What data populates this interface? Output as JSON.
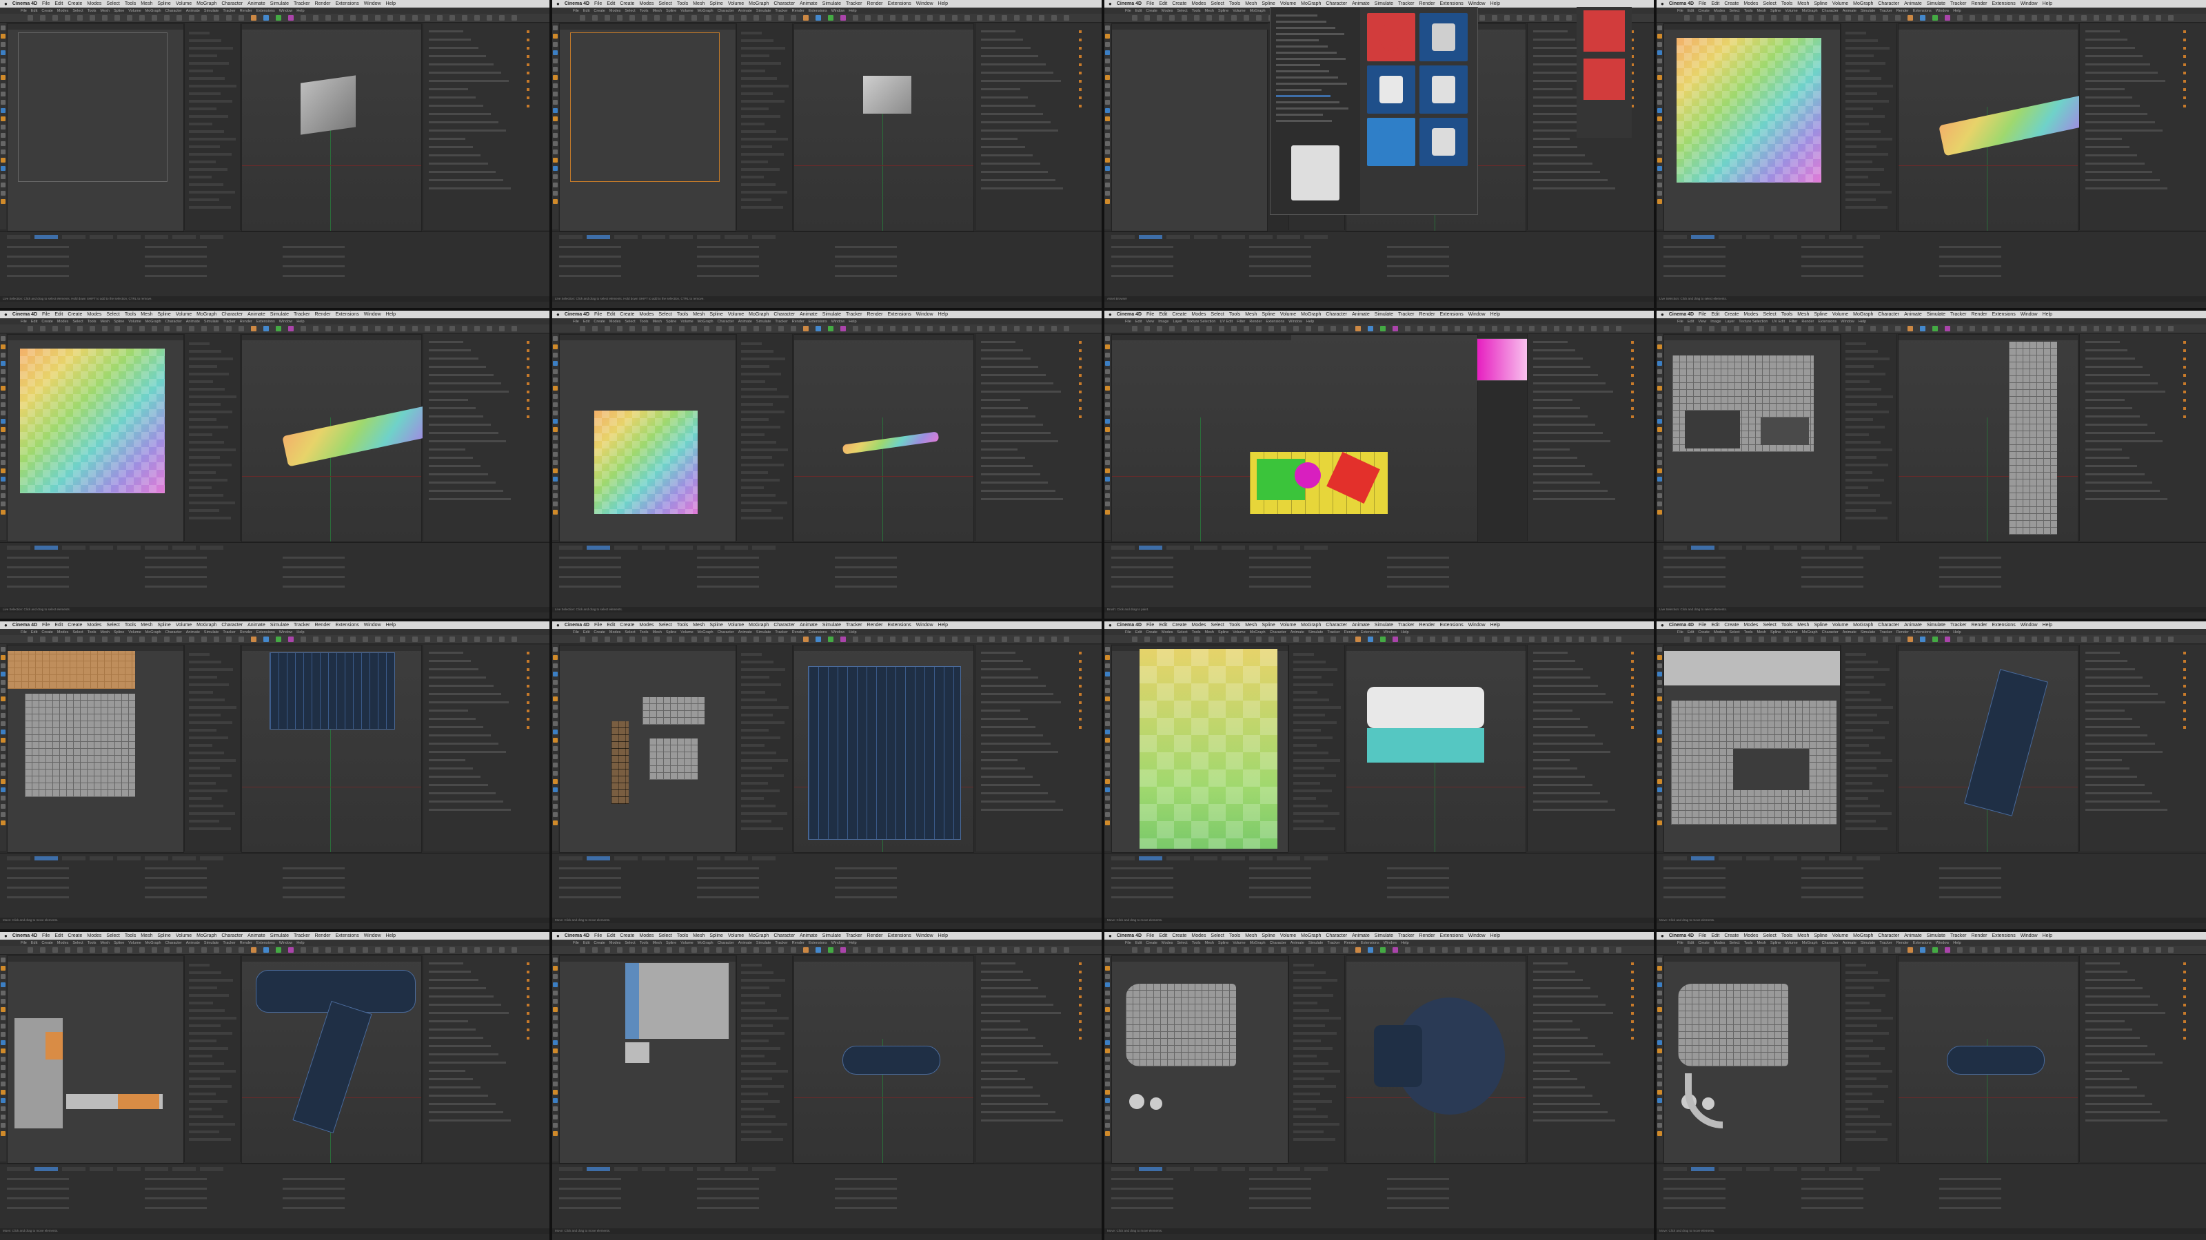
{
  "menubar": {
    "app_name": "Cinema 4D",
    "items": [
      "File",
      "Edit",
      "Create",
      "Modes",
      "Select",
      "Tools",
      "Mesh",
      "Spline",
      "Volume",
      "MoGraph",
      "Character",
      "Animate",
      "Simulate",
      "Tracker",
      "Render",
      "Extensions",
      "Window",
      "Help"
    ],
    "alt_items": [
      "File",
      "Edit",
      "View",
      "Image",
      "Layer",
      "Texture Selection",
      "UV Edit",
      "Filter",
      "Render",
      "Extensions",
      "Window",
      "Help"
    ]
  },
  "panels": [
    {
      "id": "p01",
      "variant": "cube",
      "uv": "empty",
      "object": "cube-grey",
      "status": "Live Selection: Click and drag to select elements. Hold down SHIFT to add to the selection, CTRL to remove."
    },
    {
      "id": "p02",
      "variant": "cube-orange-frame",
      "uv": "empty",
      "object": "cube-grey-small",
      "status": "Live Selection: Click and drag to select elements. Hold down SHIFT to add to the selection, CTRL to remove."
    },
    {
      "id": "p03",
      "variant": "asset-browser",
      "uv": "asset",
      "object": "none",
      "status": "Asset Browser"
    },
    {
      "id": "p04",
      "variant": "rainbow-uv",
      "uv": "rainbow",
      "object": "tube-rainbow",
      "status": "Live Selection: Click and drag to select elements."
    },
    {
      "id": "p05",
      "variant": "rainbow-uv",
      "uv": "rainbow",
      "object": "tube-rainbow",
      "status": "Live Selection: Click and drag to select elements."
    },
    {
      "id": "p06",
      "variant": "rainbow-uv-small",
      "uv": "rainbow",
      "object": "tube-rainbow-thin",
      "status": "Live Selection: Click and drag to select elements."
    },
    {
      "id": "p07",
      "variant": "bodypaint",
      "uv": "paint",
      "object": "paint-box",
      "status": "Brush: Click and drag to paint."
    },
    {
      "id": "p08",
      "variant": "grey-uv",
      "uv": "grey",
      "object": "strip",
      "status": "Live Selection: Click and drag to select elements."
    },
    {
      "id": "p09",
      "variant": "orange-uv",
      "uv": "orange",
      "object": "blue-box",
      "status": "Move: Click and drag to move elements."
    },
    {
      "id": "p10",
      "variant": "islands",
      "uv": "islands",
      "object": "blue-box-large",
      "status": "Move: Click and drag to move elements."
    },
    {
      "id": "p11",
      "variant": "checker",
      "uv": "checker",
      "object": "cyan-box",
      "status": "Move: Click and drag to move elements."
    },
    {
      "id": "p12",
      "variant": "gun-uv",
      "uv": "gun",
      "object": "gun-handle",
      "status": "Move: Click and drag to move elements."
    },
    {
      "id": "p13",
      "variant": "gun-uv2",
      "uv": "gun2",
      "object": "gun",
      "status": "Move: Click and drag to move elements."
    },
    {
      "id": "p14",
      "variant": "bar-uv",
      "uv": "bar",
      "object": "capsule",
      "status": "Move: Click and drag to move elements."
    },
    {
      "id": "p15",
      "variant": "cyl-uv",
      "uv": "cyl",
      "object": "lens",
      "status": "Move: Click and drag to move elements."
    },
    {
      "id": "p16",
      "variant": "cyl-uv2",
      "uv": "cyl2",
      "object": "capsule-2",
      "status": "Move: Click and drag to move elements."
    }
  ],
  "colors": {
    "ui_bg": "#2b2b2b",
    "selection_orange": "#e08a2e",
    "active_blue": "#3e6ea8",
    "mesh_blue": "#1f2f45"
  },
  "icons": [
    "apple-icon",
    "move-icon",
    "scale-icon",
    "rotate-icon",
    "render-icon",
    "axis-gizmo-icon"
  ]
}
